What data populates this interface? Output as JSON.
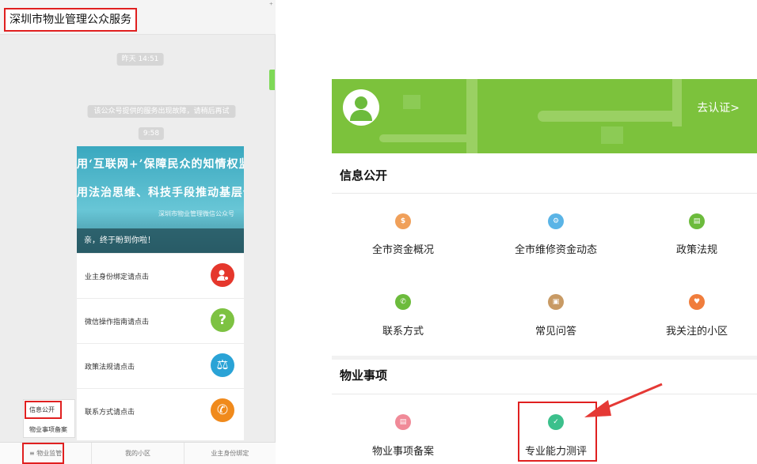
{
  "left_panel": {
    "title": "深圳市物业管理公众服务",
    "corner_mark": "⁺",
    "time_1": "昨天 14:51",
    "system_msg": "该公众号提供的服务出现故障，请稍后再试",
    "time_2": "9:58",
    "banner": {
      "line1": "用‘互联网+’保障民众的知情权监督权",
      "line2": "用法治思维、科技手段推动基层依法治理",
      "signature": "深圳市物业管理微信公众号",
      "strip": "亲，终于盼到你啦！"
    },
    "items": [
      {
        "label": "业主身份绑定请点击",
        "icon": "user-badge-icon",
        "color": "#e5372c",
        "glyph": "👤"
      },
      {
        "label": "微信操作指南请点击",
        "icon": "question-icon",
        "color": "#7dc242",
        "glyph": "?"
      },
      {
        "label": "政策法规请点击",
        "icon": "scale-icon",
        "color": "#2aa3d6",
        "glyph": "⚖"
      },
      {
        "label": "联系方式请点击",
        "icon": "phone-icon",
        "color": "#f08a1c",
        "glyph": "✆"
      }
    ],
    "popup_menu": [
      "信息公开",
      "物业事项备案"
    ],
    "bottom_nav": [
      "≡ 物业监管",
      "我的小区",
      "业主身份绑定"
    ]
  },
  "right_panel": {
    "verify_link": "去认证>",
    "section1_title": "信息公开",
    "section1_items": [
      {
        "label": "全市资金概况",
        "icon": "fund-overview-icon",
        "color": "#f0a05a",
        "glyph": "$"
      },
      {
        "label": "全市维修资金动态",
        "icon": "gear-icon",
        "color": "#5ab4e6",
        "glyph": "⚙"
      },
      {
        "label": "政策法规",
        "icon": "document-icon",
        "color": "#6cbb3c",
        "glyph": "▤"
      },
      {
        "label": "联系方式",
        "icon": "phone-icon",
        "color": "#6cbb3c",
        "glyph": "✆"
      },
      {
        "label": "常见问答",
        "icon": "chat-icon",
        "color": "#c89a64",
        "glyph": "▣"
      },
      {
        "label": "我关注的小区",
        "icon": "heart-icon",
        "color": "#f07d3c",
        "glyph": "♥"
      }
    ],
    "section2_title": "物业事项",
    "section2_items": [
      {
        "label": "物业事项备案",
        "icon": "record-icon",
        "color": "#f08a98",
        "glyph": "▤"
      },
      {
        "label": "专业能力测评",
        "icon": "shield-icon",
        "color": "#3cc08c",
        "glyph": "✓"
      }
    ]
  },
  "colors": {
    "accent_red": "#e02020",
    "hero_green": "#7cc23c",
    "arrow_red": "#e53935"
  }
}
